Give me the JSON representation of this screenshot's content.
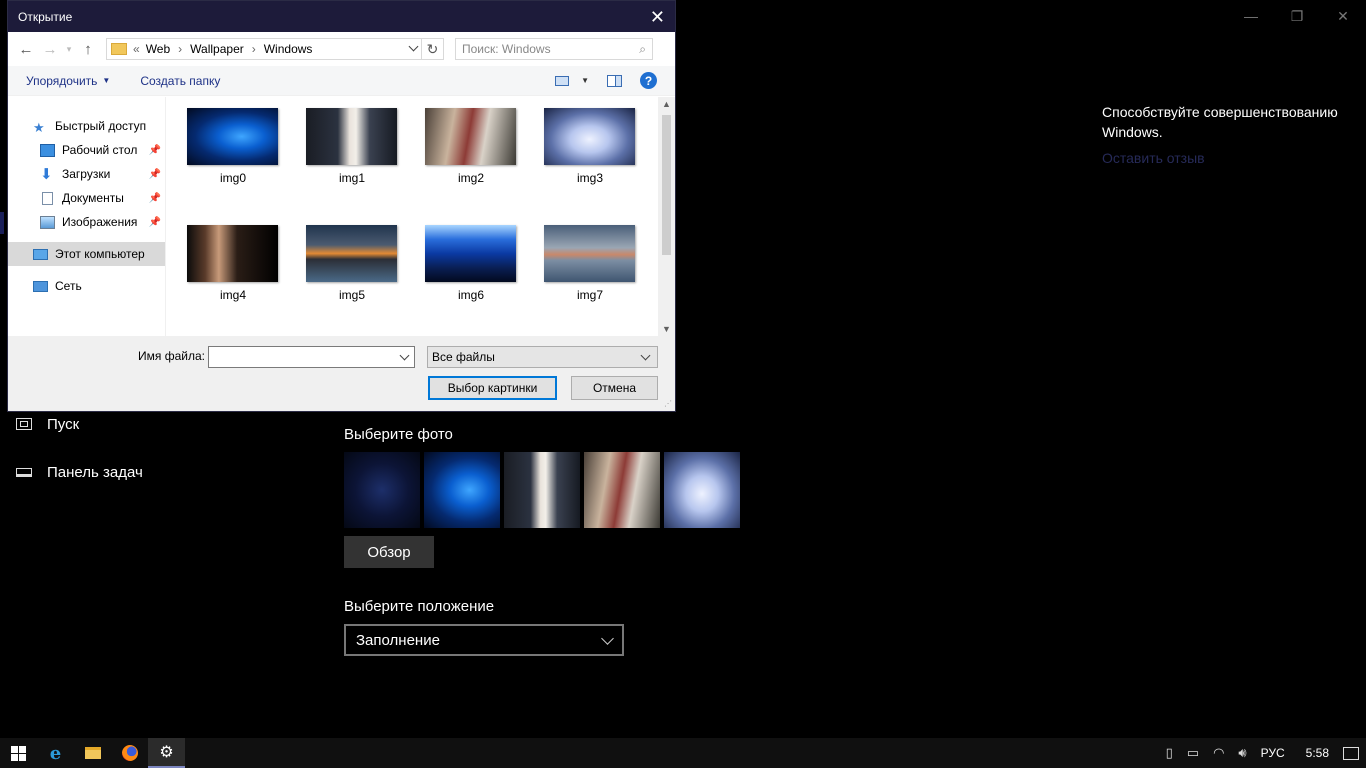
{
  "window_controls": {
    "minimize": "—",
    "restore": "❐",
    "close": "✕"
  },
  "settings": {
    "nav": [
      {
        "label": "Пуск",
        "icon": "start-icon"
      },
      {
        "label": "Панель задач",
        "icon": "taskbar-icon"
      }
    ],
    "feedback_text": "Способствуйте совершенствованию Windows.",
    "feedback_link": "Оставить отзыв",
    "choose_photo": "Выберите фото",
    "browse_button": "Обзор",
    "choose_fit": "Выберите положение",
    "fit_value": "Заполнение",
    "recent_photos": [
      "windows-dark",
      "windows-blue",
      "girl-1",
      "girl-2",
      "anime"
    ]
  },
  "dialog": {
    "title": "Открытие",
    "close": "✕",
    "breadcrumb": {
      "overflow": "«",
      "items": [
        "Web",
        "Wallpaper",
        "Windows"
      ]
    },
    "search_placeholder": "Поиск: Windows",
    "toolbar": {
      "organize": "Упорядочить",
      "new_folder": "Создать папку"
    },
    "nav_pane": [
      {
        "label": "Быстрый доступ",
        "icon": "star-icon",
        "level": 1,
        "pinned": false
      },
      {
        "label": "Рабочий стол",
        "icon": "desktop-icon",
        "level": 2,
        "pinned": true
      },
      {
        "label": "Загрузки",
        "icon": "download-icon",
        "level": 2,
        "pinned": true
      },
      {
        "label": "Документы",
        "icon": "document-icon",
        "level": 2,
        "pinned": true
      },
      {
        "label": "Изображения",
        "icon": "pictures-icon",
        "level": 2,
        "pinned": true
      },
      {
        "label": "Этот компьютер",
        "icon": "computer-icon",
        "level": 1,
        "selected": true
      },
      {
        "label": "Сеть",
        "icon": "network-icon",
        "level": 1
      }
    ],
    "files": [
      {
        "name": "img0"
      },
      {
        "name": "img1"
      },
      {
        "name": "img2"
      },
      {
        "name": "img3"
      },
      {
        "name": "img4"
      },
      {
        "name": "img5"
      },
      {
        "name": "img6"
      },
      {
        "name": "img7"
      }
    ],
    "filename_label": "Имя файла:",
    "filename_value": "",
    "filetype_value": "Все файлы",
    "ok_button": "Выбор картинки",
    "cancel_button": "Отмена"
  },
  "taskbar": {
    "language": "РУС",
    "time": "5:58"
  }
}
